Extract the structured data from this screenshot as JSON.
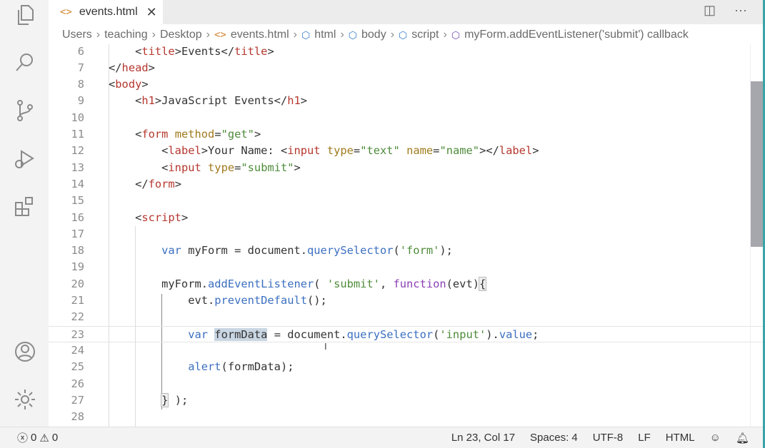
{
  "activity_bar": [
    {
      "icon": "files-icon"
    },
    {
      "icon": "search-icon"
    },
    {
      "icon": "source-control-icon"
    },
    {
      "icon": "run-debug-icon"
    },
    {
      "icon": "extensions-icon"
    },
    {
      "icon": "account-icon"
    },
    {
      "icon": "gear-icon"
    }
  ],
  "tab": {
    "label": "events.html",
    "icon": "<>",
    "close": "✕"
  },
  "tab_actions": {
    "split": "◫",
    "more": "···"
  },
  "breadcrumbs": [
    "Users",
    "teaching",
    "Desktop",
    "events.html",
    "html",
    "body",
    "script",
    "myForm.addEventListener('submit') callback"
  ],
  "editor": {
    "current_line": 23,
    "lines": [
      {
        "n": "6",
        "t": [
          [
            "p",
            "    <"
          ],
          [
            "tag",
            "title"
          ],
          [
            "p",
            ">Events</"
          ],
          [
            "tag",
            "title"
          ],
          [
            "p",
            ">"
          ]
        ]
      },
      {
        "n": "7",
        "t": [
          [
            "p",
            "</"
          ],
          [
            "tag",
            "head"
          ],
          [
            "p",
            ">"
          ]
        ]
      },
      {
        "n": "8",
        "t": [
          [
            "p",
            "<"
          ],
          [
            "tag",
            "body"
          ],
          [
            "p",
            ">"
          ]
        ]
      },
      {
        "n": "9",
        "t": [
          [
            "p",
            "    <"
          ],
          [
            "tag",
            "h1"
          ],
          [
            "p",
            ">JavaScript Events</"
          ],
          [
            "tag",
            "h1"
          ],
          [
            "p",
            ">"
          ]
        ]
      },
      {
        "n": "10",
        "t": []
      },
      {
        "n": "11",
        "t": [
          [
            "p",
            "    <"
          ],
          [
            "tag",
            "form"
          ],
          [
            "p",
            " "
          ],
          [
            "attr",
            "method"
          ],
          [
            "p",
            "="
          ],
          [
            "str",
            "\"get\""
          ],
          [
            "p",
            ">"
          ]
        ]
      },
      {
        "n": "12",
        "t": [
          [
            "p",
            "        <"
          ],
          [
            "tag",
            "label"
          ],
          [
            "p",
            ">Your Name: <"
          ],
          [
            "tag",
            "input"
          ],
          [
            "p",
            " "
          ],
          [
            "attr",
            "type"
          ],
          [
            "p",
            "="
          ],
          [
            "str",
            "\"text\""
          ],
          [
            "p",
            " "
          ],
          [
            "attr",
            "name"
          ],
          [
            "p",
            "="
          ],
          [
            "str",
            "\"name\""
          ],
          [
            "p",
            "></"
          ],
          [
            "tag",
            "label"
          ],
          [
            "p",
            ">"
          ]
        ]
      },
      {
        "n": "13",
        "t": [
          [
            "p",
            "        <"
          ],
          [
            "tag",
            "input"
          ],
          [
            "p",
            " "
          ],
          [
            "attr",
            "type"
          ],
          [
            "p",
            "="
          ],
          [
            "str",
            "\"submit\""
          ],
          [
            "p",
            ">"
          ]
        ]
      },
      {
        "n": "14",
        "t": [
          [
            "p",
            "    </"
          ],
          [
            "tag",
            "form"
          ],
          [
            "p",
            ">"
          ]
        ]
      },
      {
        "n": "15",
        "t": []
      },
      {
        "n": "16",
        "t": [
          [
            "p",
            "    <"
          ],
          [
            "tag",
            "script"
          ],
          [
            "p",
            ">"
          ]
        ]
      },
      {
        "n": "17",
        "t": []
      },
      {
        "n": "18",
        "t": [
          [
            "p",
            "        "
          ],
          [
            "kw",
            "var"
          ],
          [
            "p",
            " myForm = document."
          ],
          [
            "fn",
            "querySelector"
          ],
          [
            "p",
            "("
          ],
          [
            "str",
            "'form'"
          ],
          [
            "p",
            ");"
          ]
        ]
      },
      {
        "n": "19",
        "t": []
      },
      {
        "n": "20",
        "t": [
          [
            "p",
            "        myForm."
          ],
          [
            "fn",
            "addEventListener"
          ],
          [
            "p",
            "( "
          ],
          [
            "str",
            "'submit'"
          ],
          [
            "p",
            ", "
          ],
          [
            "fk",
            "function"
          ],
          [
            "p",
            "(evt)"
          ],
          [
            "brk",
            "{"
          ]
        ]
      },
      {
        "n": "21",
        "t": [
          [
            "p",
            "            evt."
          ],
          [
            "fn",
            "preventDefault"
          ],
          [
            "p",
            "();"
          ]
        ]
      },
      {
        "n": "22",
        "t": []
      },
      {
        "n": "23",
        "t": [
          [
            "p",
            "            "
          ],
          [
            "kw",
            "var"
          ],
          [
            "p",
            " "
          ],
          [
            "sel",
            "formData"
          ],
          [
            "p",
            " = document."
          ],
          [
            "fn",
            "querySelector"
          ],
          [
            "p",
            "("
          ],
          [
            "str",
            "'input'"
          ],
          [
            "p",
            ")."
          ],
          [
            "prop",
            "value"
          ],
          [
            "p",
            ";"
          ]
        ]
      },
      {
        "n": "24",
        "t": []
      },
      {
        "n": "25",
        "t": [
          [
            "p",
            "            "
          ],
          [
            "fn",
            "alert"
          ],
          [
            "p",
            "(formData);"
          ]
        ]
      },
      {
        "n": "26",
        "t": []
      },
      {
        "n": "27",
        "t": [
          [
            "p",
            "        "
          ],
          [
            "brk",
            "}"
          ],
          [
            "p",
            " );"
          ]
        ]
      },
      {
        "n": "28",
        "t": []
      }
    ]
  },
  "status": {
    "errors": "0",
    "warnings": "0",
    "position": "Ln 23, Col 17",
    "spaces": "Spaces: 4",
    "encoding": "UTF-8",
    "eol": "LF",
    "language": "HTML"
  },
  "colors": {
    "tag": "#b5372e",
    "attribute": "#a07a1c",
    "string": "#4e8b3a",
    "keyword": "#3b6fc0",
    "function_keyword": "#8a3fb3",
    "accent_edge": "#39a5a8"
  }
}
